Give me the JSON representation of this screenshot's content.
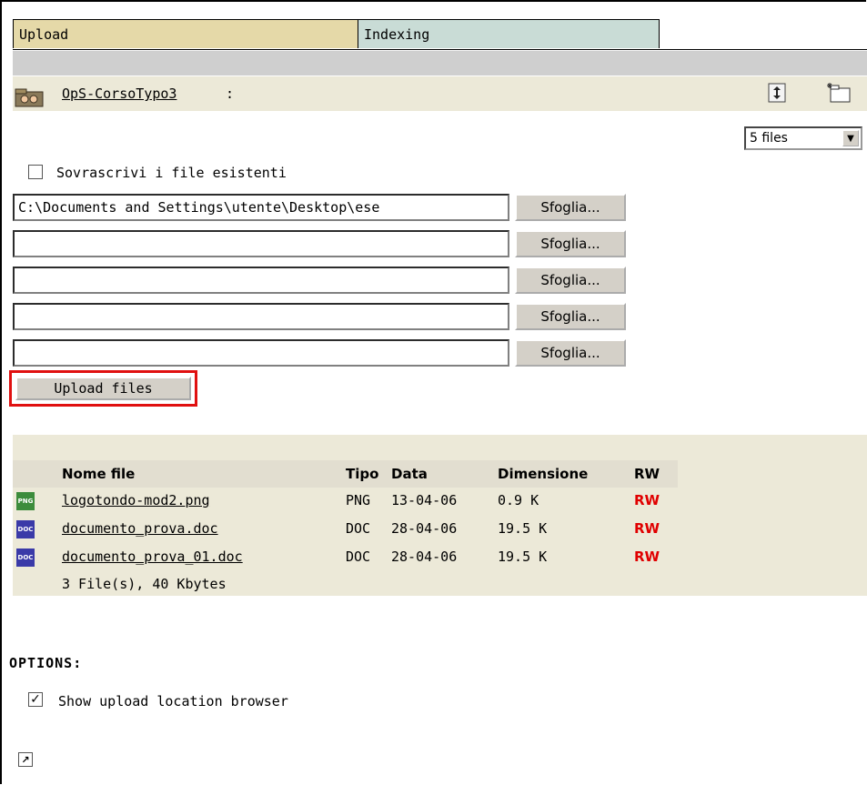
{
  "tabs": [
    {
      "label": "Upload"
    },
    {
      "label": "Indexing"
    }
  ],
  "path": {
    "folder": "OpS-CorsoTypo3",
    "suffix": ":"
  },
  "toolbar": {
    "refresh_icon": "refresh-icon",
    "newfolder_icon": "new-folder-icon"
  },
  "file_count_select": {
    "value": "5 files"
  },
  "overwrite": {
    "label": "Sovrascrivi i file esistenti",
    "checked": false
  },
  "file_inputs": [
    {
      "value": "C:\\Documents and Settings\\utente\\Desktop\\ese"
    },
    {
      "value": ""
    },
    {
      "value": ""
    },
    {
      "value": ""
    },
    {
      "value": ""
    }
  ],
  "browse_label": "Sfoglia...",
  "upload_button": "Upload files",
  "file_list": {
    "headers": {
      "name": "Nome file",
      "type": "Tipo",
      "date": "Data",
      "size": "Dimensione",
      "rw": "RW"
    },
    "rows": [
      {
        "icon": "PNG",
        "name": "logotondo-mod2.png",
        "type": "PNG",
        "date": "13-04-06",
        "size": "0.9 K",
        "rw": "RW"
      },
      {
        "icon": "DOC",
        "name": "documento_prova.doc",
        "type": "DOC",
        "date": "28-04-06",
        "size": "19.5 K",
        "rw": "RW"
      },
      {
        "icon": "DOC",
        "name": "documento_prova_01.doc",
        "type": "DOC",
        "date": "28-04-06",
        "size": "19.5 K",
        "rw": "RW"
      }
    ],
    "summary": "3 File(s), 40 Kbytes"
  },
  "options": {
    "title": "OPTIONS:",
    "show_location_label": "Show upload location browser",
    "show_location_checked": true
  },
  "colors": {
    "tab_upload": "#e5d9a8",
    "tab_indexing": "#c9dcd6",
    "rw": "#e00000",
    "highlight": "#e01010",
    "png_icon": "#3c8c3c",
    "doc_icon": "#3a3aa8"
  }
}
